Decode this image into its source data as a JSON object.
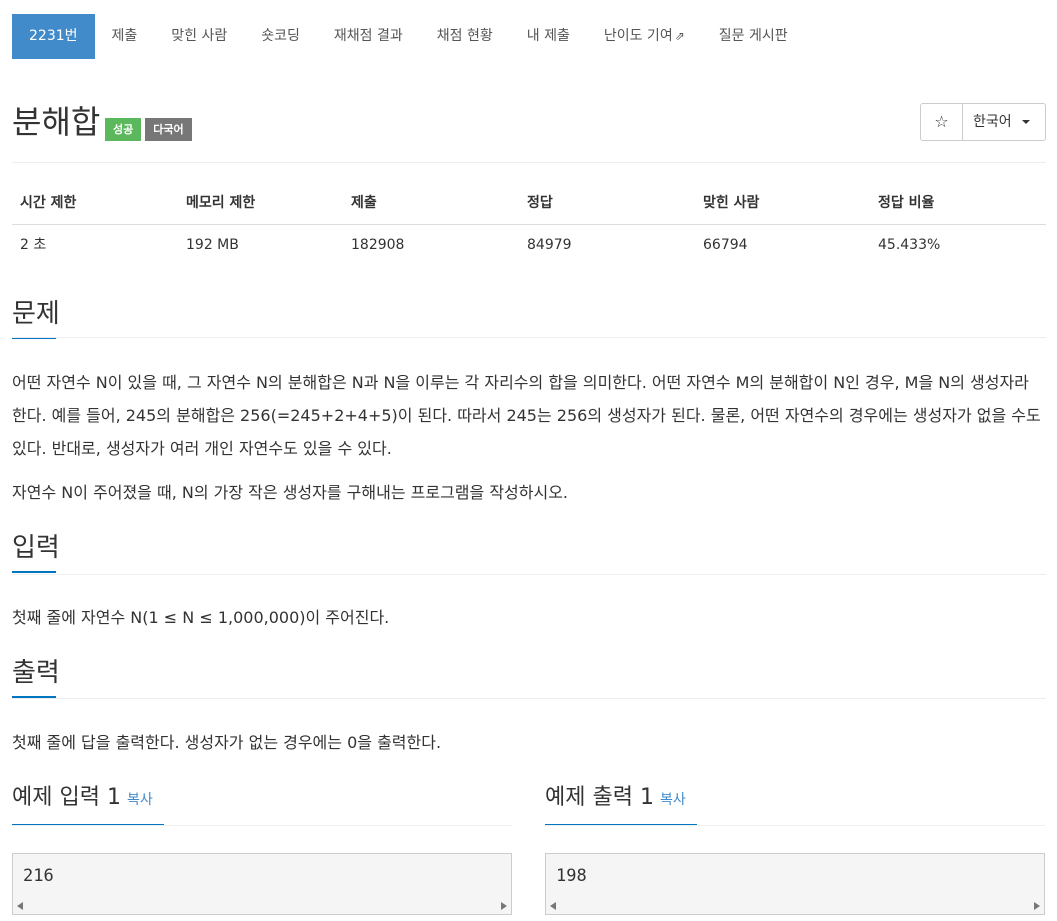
{
  "tabs": [
    {
      "label": "2231번"
    },
    {
      "label": "제출"
    },
    {
      "label": "맞힌 사람"
    },
    {
      "label": "숏코딩"
    },
    {
      "label": "재채점 결과"
    },
    {
      "label": "채점 현황"
    },
    {
      "label": "내 제출"
    },
    {
      "label": "난이도 기여"
    },
    {
      "label": "질문 게시판"
    }
  ],
  "problem": {
    "title": "분해합",
    "badge_success": "성공",
    "badge_lang": "다국어",
    "star": "☆",
    "language": "한국어"
  },
  "info": {
    "headers": [
      "시간 제한",
      "메모리 제한",
      "제출",
      "정답",
      "맞힌 사람",
      "정답 비율"
    ],
    "values": [
      "2 초",
      "192 MB",
      "182908",
      "84979",
      "66794",
      "45.433%"
    ]
  },
  "sections": {
    "problem_title": "문제",
    "problem_p1": "어떤 자연수 N이 있을 때, 그 자연수 N의 분해합은 N과 N을 이루는 각 자리수의 합을 의미한다. 어떤 자연수 M의 분해합이 N인 경우, M을 N의 생성자라 한다. 예를 들어, 245의 분해합은 256(=245+2+4+5)이 된다. 따라서 245는 256의 생성자가 된다. 물론, 어떤 자연수의 경우에는 생성자가 없을 수도 있다. 반대로, 생성자가 여러 개인 자연수도 있을 수 있다.",
    "problem_p2": "자연수 N이 주어졌을 때, N의 가장 작은 생성자를 구해내는 프로그램을 작성하시오.",
    "input_title": "입력",
    "input_p": "첫째 줄에 자연수 N(1 ≤ N ≤ 1,000,000)이 주어진다.",
    "output_title": "출력",
    "output_p": "첫째 줄에 답을 출력한다. 생성자가 없는 경우에는 0을 출력한다."
  },
  "samples": {
    "input_title": "예제 입력 1",
    "input_copy": "복사",
    "input_value": "216",
    "output_title": "예제 출력 1",
    "output_copy": "복사",
    "output_value": "198"
  }
}
